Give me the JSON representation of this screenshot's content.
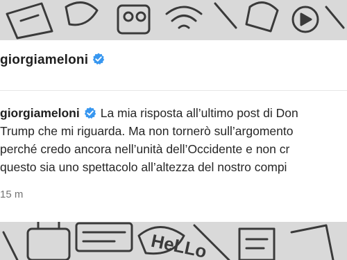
{
  "post": {
    "username": "giorgiameloni",
    "caption_username": "giorgiameloni",
    "caption_lines": [
      "La mia risposta all’ultimo post di Don",
      "Trump che mi riguarda. Ma non tornerò sull’argomento",
      "perché credo ancora nell’unità dell’Occidente e non cr",
      "questo sia uno spettacolo all’altezza del nostro compi"
    ],
    "timestamp": "15 m"
  },
  "colors": {
    "verified": "#3897f0",
    "background": "#d9d9d9",
    "card": "#ffffff"
  }
}
